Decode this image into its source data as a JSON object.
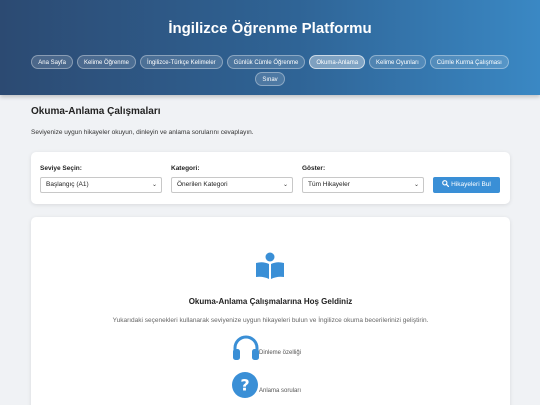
{
  "header": {
    "title": "İngilizce Öğrenme Platformu",
    "nav": [
      {
        "label": "Ana Sayfa",
        "active": false
      },
      {
        "label": "Kelime Öğrenme",
        "active": false
      },
      {
        "label": "İngilizce-Türkçe Kelimeler",
        "active": false
      },
      {
        "label": "Günlük Cümle Öğrenme",
        "active": false
      },
      {
        "label": "Okuma-Anlama",
        "active": true
      },
      {
        "label": "Kelime Oyunları",
        "active": false
      },
      {
        "label": "Cümle Kurma Çalışması",
        "active": false
      },
      {
        "label": "Sınav",
        "active": false
      }
    ]
  },
  "page": {
    "title": "Okuma-Anlama Çalışmaları",
    "description": "Seviyenize uygun hikayeler okuyun, dinleyin ve anlama sorularını cevaplayın."
  },
  "filters": {
    "level": {
      "label": "Seviye Seçin:",
      "value": "Başlangıç (A1)"
    },
    "category": {
      "label": "Kategori:",
      "value": "Önerilen Kategori"
    },
    "show": {
      "label": "Göster:",
      "value": "Tüm Hikayeler"
    },
    "button_label": "Hikayeleri Bul"
  },
  "welcome": {
    "title": "Okuma-Anlama Çalışmalarına Hoş Geldiniz",
    "description": "Yukarıdaki seçenekleri kullanarak seviyenize uygun hikayeleri bulun ve İngilizce okuma becerilerinizi geliştirin.",
    "features": [
      {
        "icon": "headphones-icon",
        "label": "Dinleme özelliği"
      },
      {
        "icon": "question-icon",
        "label": "Anlama soruları"
      }
    ]
  },
  "colors": {
    "accent": "#3a8fd6",
    "header_start": "#2c4a72",
    "header_end": "#3a88c4"
  }
}
